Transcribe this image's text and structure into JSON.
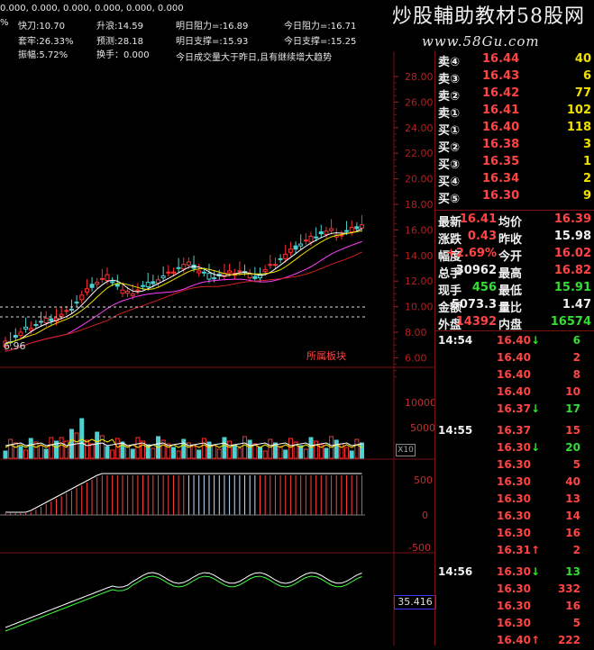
{
  "top_line": "0.000, 0.000, 0.000, 0.000, 0.000, 0.000",
  "header": {
    "pct_cut": "%",
    "r1": [
      "快刀:10.70",
      "升浪:14.59",
      "明日阻力=:16.89",
      "今日阻力=:16.71"
    ],
    "r2": [
      "套牢:26.33%",
      "预测:28.18",
      "明日支撑=:15.93",
      "今日支撑=:15.25"
    ],
    "r3": [
      "振幅:5.72%",
      "换手：0.000"
    ],
    "note": "今日成交量大于昨日,且有继续增大趋势"
  },
  "watermark": {
    "title": "炒股輔助教材58股网",
    "url": "www.58Gu.com"
  },
  "price_axis": [
    "28.00",
    "26.00",
    "24.00",
    "22.00",
    "20.00",
    "18.00",
    "16.00",
    "14.00",
    "12.00",
    "10.00",
    "8.00",
    "6.00"
  ],
  "low_label": "6.96",
  "sector_label": "所属板块",
  "vol_axis": [
    "10000",
    "5000"
  ],
  "vol_unit": "X10",
  "macd_axis": [
    "500",
    "0",
    "-500"
  ],
  "kdj_value": "35.416",
  "order_book": [
    {
      "label": "卖④",
      "price": "16.44",
      "vol": "40"
    },
    {
      "label": "卖③",
      "price": "16.43",
      "vol": "6"
    },
    {
      "label": "卖②",
      "price": "16.42",
      "vol": "77"
    },
    {
      "label": "卖①",
      "price": "16.41",
      "vol": "102"
    },
    {
      "label": "买①",
      "price": "16.40",
      "vol": "118"
    },
    {
      "label": "买②",
      "price": "16.38",
      "vol": "3"
    },
    {
      "label": "买③",
      "price": "16.35",
      "vol": "1"
    },
    {
      "label": "买④",
      "price": "16.34",
      "vol": "2"
    },
    {
      "label": "买⑤",
      "price": "16.30",
      "vol": "9"
    }
  ],
  "stats": [
    {
      "k1": "最新",
      "v1": "16.41",
      "k2": "均价",
      "v2": "16.39"
    },
    {
      "k1": "涨跌",
      "v1": "0.43",
      "k2": "昨收",
      "v2": "15.98"
    },
    {
      "k1": "幅度",
      "v1": "+2.69%",
      "k2": "今开",
      "v2": "16.02"
    },
    {
      "k1": "总手",
      "v1": "30962",
      "k2": "最高",
      "v2": "16.82"
    },
    {
      "k1": "现手",
      "v1": "456",
      "k2": "最低",
      "v2": "15.91"
    },
    {
      "k1": "金额",
      "v1": "5073.3",
      "k2": "量比",
      "v2": "1.47"
    },
    {
      "k1": "外盘",
      "v1": "14392",
      "k2": "内盘",
      "v2": "16574"
    }
  ],
  "ticks": [
    {
      "time": "14:54",
      "price": "16.40",
      "arrow": "down",
      "vol": "6"
    },
    {
      "time": "",
      "price": "16.40",
      "arrow": "",
      "vol": "2"
    },
    {
      "time": "",
      "price": "16.40",
      "arrow": "",
      "vol": "8"
    },
    {
      "time": "",
      "price": "16.40",
      "arrow": "",
      "vol": "10"
    },
    {
      "time": "",
      "price": "16.37",
      "arrow": "down",
      "vol": "17"
    },
    {
      "time": "14:55",
      "price": "16.37",
      "arrow": "",
      "vol": "15"
    },
    {
      "time": "",
      "price": "16.30",
      "arrow": "down",
      "vol": "20"
    },
    {
      "time": "",
      "price": "16.30",
      "arrow": "",
      "vol": "5"
    },
    {
      "time": "",
      "price": "16.30",
      "arrow": "",
      "vol": "40"
    },
    {
      "time": "",
      "price": "16.30",
      "arrow": "",
      "vol": "13"
    },
    {
      "time": "",
      "price": "16.30",
      "arrow": "",
      "vol": "14"
    },
    {
      "time": "",
      "price": "16.30",
      "arrow": "",
      "vol": "16"
    },
    {
      "time": "",
      "price": "16.31",
      "arrow": "up",
      "vol": "2"
    },
    {
      "time": "14:56",
      "price": "16.30",
      "arrow": "down",
      "vol": "13"
    },
    {
      "time": "",
      "price": "16.30",
      "arrow": "",
      "vol": "332"
    },
    {
      "time": "",
      "price": "16.30",
      "arrow": "",
      "vol": "16"
    },
    {
      "time": "",
      "price": "16.30",
      "arrow": "",
      "vol": "5"
    },
    {
      "time": "",
      "price": "16.40",
      "arrow": "up",
      "vol": "222"
    }
  ]
}
